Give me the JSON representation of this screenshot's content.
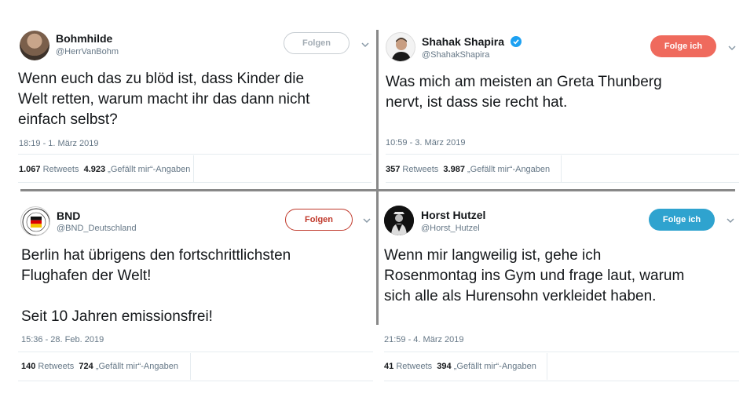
{
  "tweets": [
    {
      "name": "Bohmhilde",
      "handle": "@HerrVanBohm",
      "follow_label": "Folgen",
      "text": "Wenn euch das zu blöd ist, dass Kinder die\nWelt retten, warum macht ihr das dann nicht\neinfach selbst?",
      "timestamp": "18:19 - 1. März 2019",
      "retweets": "1.067",
      "retweets_label": "Retweets",
      "likes": "4.923",
      "likes_label": "„Gefällt mir“-Angaben",
      "avatar_icon": "user-photo-icon"
    },
    {
      "name": "Shahak Shapira",
      "handle": "@ShahakShapira",
      "verified": true,
      "follow_label": "Folge ich",
      "text": "Was mich am meisten an Greta Thunberg\nnervt, ist dass sie recht hat.",
      "timestamp": "10:59 - 3. März 2019",
      "retweets": "357",
      "retweets_label": "Retweets",
      "likes": "3.987",
      "likes_label": "„Gefällt mir“-Angaben",
      "avatar_icon": "user-photo-icon"
    },
    {
      "name": "BND",
      "handle": "@BND_Deutschland",
      "follow_label": "Folgen",
      "text": "Berlin hat übrigens den fortschrittlichsten\nFlughafen der Welt!\n\nSeit 10 Jahren emissionsfrei!",
      "timestamp": "15:36 - 28. Feb. 2019",
      "retweets": "140",
      "retweets_label": "Retweets",
      "likes": "724",
      "likes_label": "„Gefällt mir“-Angaben",
      "avatar_icon": "bnd-seal-icon"
    },
    {
      "name": "Horst Hutzel",
      "handle": "@Horst_Hutzel",
      "follow_label": "Folge ich",
      "text": "Wenn mir langweilig ist, gehe ich\nRosenmontag ins Gym und frage laut, warum\nsich alle als Hurensohn verkleidet haben.",
      "timestamp": "21:59 - 4. März 2019",
      "retweets": "41",
      "retweets_label": "Retweets",
      "likes": "394",
      "likes_label": "„Gefällt mir“-Angaben",
      "avatar_icon": "user-photo-icon"
    }
  ],
  "colors": {
    "follow_coral": "#ef6a5d",
    "follow_blue": "#2fa3cf",
    "follow_red_outline": "#c0392b",
    "verified_blue": "#1da1f2"
  }
}
